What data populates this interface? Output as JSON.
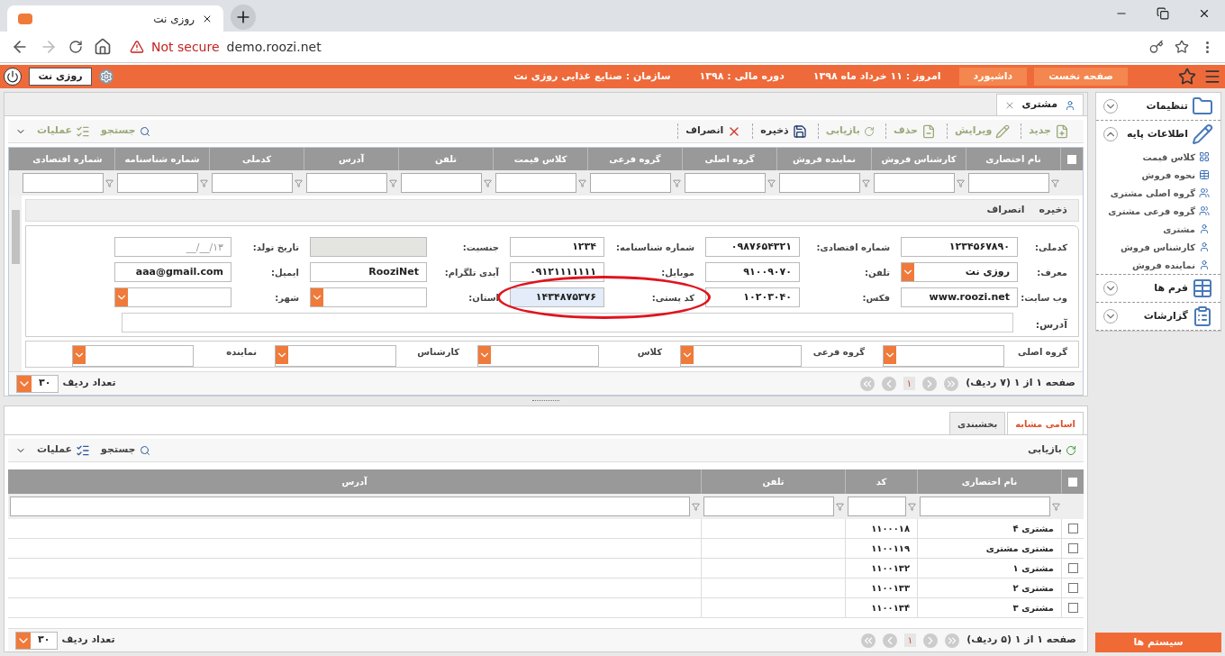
{
  "browser": {
    "tab_title": "روزی نت",
    "security": "Not secure",
    "url": "demo.roozi.net"
  },
  "header": {
    "buttons": [
      "صفحه نخست",
      "داشبورد"
    ],
    "info": [
      "امروز : ۱۱ خرداد ماه ۱۳۹۸",
      "دوره مالی : ۱۳۹۸",
      "سازمان : صنایع غذایی روزی نت"
    ],
    "user": "روزی نت"
  },
  "page_tab": {
    "label": "مشتری"
  },
  "toolbar": [
    {
      "label": "جدید",
      "kind": "new",
      "disabled": true
    },
    {
      "label": "ویرایش",
      "kind": "edit",
      "disabled": true
    },
    {
      "label": "حذف",
      "kind": "delete",
      "disabled": true
    },
    {
      "label": "بازیابی",
      "kind": "refresh",
      "disabled": true
    },
    {
      "label": "ذخیره",
      "kind": "save",
      "disabled": false
    },
    {
      "label": "انصراف",
      "kind": "cancel",
      "disabled": false
    }
  ],
  "toolbar_left": [
    {
      "label": "جستجو",
      "kind": "search",
      "disabled": true
    },
    {
      "label": "عملیات",
      "kind": "operations",
      "disabled": true
    }
  ],
  "grid": {
    "select_all_checked": false,
    "columns": [
      "نام اختصاری",
      "کارشناس فروش",
      "نماینده فروش",
      "گروه اصلی",
      "گروه فرعی",
      "کلاس قیمت",
      "تلفن",
      "آدرس",
      "کدملی",
      "شماره شناسنامه",
      "شماره اقتصادی"
    ]
  },
  "form": {
    "actions": [
      "ذخیره",
      "انصراف"
    ],
    "rows": [
      [
        {
          "label": "کدملی:",
          "kind": "text",
          "value": "۱۲۳۴۵۶۷۸۹۰"
        },
        {
          "label": "شماره اقتصادی:",
          "kind": "text",
          "value": "۰۹۸۷۶۵۴۳۲۱"
        },
        {
          "label": "شماره شناسنامه:",
          "kind": "text",
          "value": "۱۲۳۴"
        },
        {
          "label": "جنسیت:",
          "kind": "disabled"
        },
        {
          "label": "تاریخ تولد:",
          "kind": "date",
          "placeholder": "__/__/۱۳"
        }
      ],
      [
        {
          "label": "معرف:",
          "kind": "dropdown",
          "value": "روزی نت"
        },
        {
          "label": "تلفن:",
          "kind": "text",
          "value": "۹۱۰۰۹۰۷۰"
        },
        {
          "label": "موبایل:",
          "kind": "text",
          "value": "۰۹۱۲۱۱۱۱۱۱۱"
        },
        {
          "label": "آیدی تلگرام:",
          "kind": "text",
          "value": "RooziNet"
        },
        {
          "label": "ایمیل:",
          "kind": "text",
          "value": "aaa@gmail.com"
        }
      ],
      [
        {
          "label": "وب سایت:",
          "kind": "text",
          "value": "www.roozi.net"
        },
        {
          "label": "فکس:",
          "kind": "text",
          "value": "۱۰۲۰۳۰۴۰"
        },
        {
          "label": "کد پستی:",
          "kind": "text",
          "value": "۱۴۳۴۸۷۵۳۷۶",
          "highlighted": true
        },
        {
          "label": "استان:",
          "kind": "dropdown"
        },
        {
          "label": "شهر:",
          "kind": "dropdown"
        }
      ]
    ],
    "address_label": "آدرس:",
    "groups": [
      "گروه اصلی",
      "گروه فرعی",
      "کلاس",
      "کارشناس",
      "نماینده"
    ]
  },
  "pager": {
    "text": "صفحه ۱ از ۱ (۷ ردیف)",
    "page": "۱",
    "page_size": "۳۰",
    "page_size_label": "تعداد ردیف"
  },
  "lower": {
    "tabs": [
      {
        "label": "اسامی مشابه",
        "selected": true
      },
      {
        "label": "بخشبندی",
        "selected": false
      }
    ],
    "toolbar": {
      "refresh": "بازیابی",
      "search": "جستجو",
      "operations": "عملیات"
    },
    "select_all_checked": false,
    "columns": [
      "نام اختصاری",
      "کد",
      "تلفن",
      "آدرس"
    ],
    "rows": [
      {
        "name": "مشتری ۴",
        "code": "۱۱۰۰۰۱۸",
        "checked": false
      },
      {
        "name": "مشتری مشتری",
        "code": "۱۱۰۰۱۱۹",
        "checked": false
      },
      {
        "name": "مشتری ۱",
        "code": "۱۱۰۰۱۳۲",
        "checked": false
      },
      {
        "name": "مشتری ۲",
        "code": "۱۱۰۰۱۳۳",
        "checked": false
      },
      {
        "name": "مشتری ۳",
        "code": "۱۱۰۰۱۳۴",
        "checked": false
      }
    ],
    "pager": {
      "text": "صفحه ۱ از ۱ (۵ ردیف)",
      "page": "۱",
      "page_size": "۳۰",
      "page_size_label": "تعداد ردیف"
    }
  },
  "sidebar": {
    "sections": [
      {
        "title": "تنظیمات",
        "expanded": false
      },
      {
        "title": "اطلاعات پایه",
        "expanded": true,
        "items": [
          "کلاس قیمت",
          "نحوه فروش",
          "گروه اصلی مشتری",
          "گروه فرعی مشتری",
          "مشتری",
          "کارشناس فروش",
          "نماینده فروش"
        ]
      },
      {
        "title": "فرم ها",
        "expanded": false
      },
      {
        "title": "گزارشات",
        "expanded": false
      }
    ],
    "footer": "سیستم ها"
  }
}
